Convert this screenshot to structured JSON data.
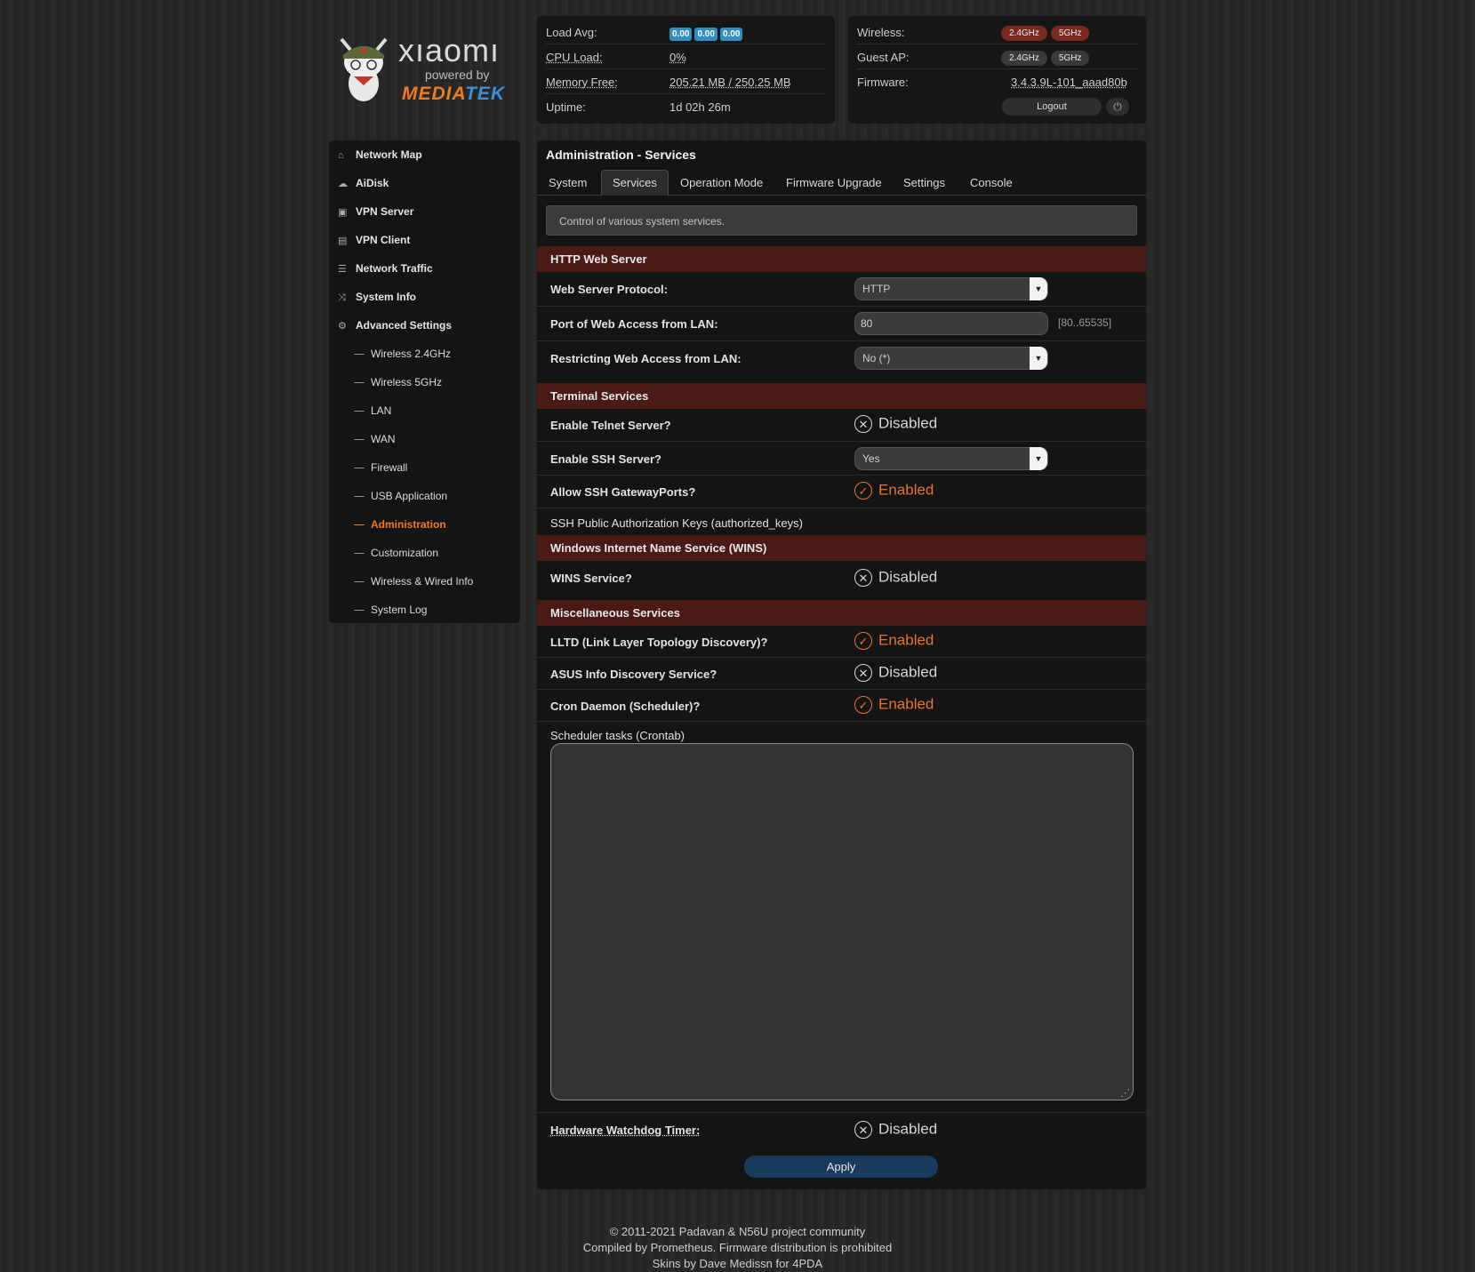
{
  "logo": {
    "brand": "xıaomı",
    "powered": "powered by",
    "mt1": "MEDIA",
    "mt2": "TEK"
  },
  "status_left": {
    "load_label": "Load Avg:",
    "load_values": [
      "0.00",
      "0.00",
      "0.00"
    ],
    "cpu_label": "CPU Load:",
    "cpu_value": "0%",
    "mem_label": "Memory Free:",
    "mem_value": "205.21 MB / 250.25 MB",
    "uptime_label": "Uptime:",
    "uptime_value": "1d 02h 26m"
  },
  "status_right": {
    "wireless_label": "Wireless:",
    "wireless_24": "2.4GHz",
    "wireless_5": "5GHz",
    "guest_label": "Guest AP:",
    "guest_24": "2.4GHz",
    "guest_5": "5GHz",
    "fw_label": "Firmware:",
    "fw_value": "3.4.3.9L-101_aaad80b",
    "logout": "Logout",
    "power_icon": "power-icon"
  },
  "sidebar": {
    "items": [
      {
        "label": "Network Map",
        "icon": "home-icon"
      },
      {
        "label": "AiDisk",
        "icon": "cloud-icon"
      },
      {
        "label": "VPN Server",
        "icon": "server-icon"
      },
      {
        "label": "VPN Client",
        "icon": "client-icon"
      },
      {
        "label": "Network Traffic",
        "icon": "list-icon"
      },
      {
        "label": "System Info",
        "icon": "shuffle-icon"
      },
      {
        "label": "Advanced Settings",
        "icon": "gear-icon"
      }
    ],
    "sub_items": [
      "Wireless 2.4GHz",
      "Wireless 5GHz",
      "LAN",
      "WAN",
      "Firewall",
      "USB Application",
      "Administration",
      "Customization",
      "Wireless & Wired Info",
      "System Log"
    ]
  },
  "main": {
    "title": "Administration - Services",
    "tabs": [
      "System",
      "Services",
      "Operation Mode",
      "Firmware Upgrade",
      "Settings",
      "Console"
    ],
    "description": "Control of various system services.",
    "sections": {
      "http": "HTTP Web Server",
      "terminal": "Terminal Services",
      "wins": "Windows Internet Name Service (WINS)",
      "misc": "Miscellaneous Services"
    },
    "fields": {
      "protocol_label": "Web Server Protocol:",
      "protocol_value": "HTTP",
      "port_label": "Port of Web Access from LAN:",
      "port_value": "80",
      "port_hint": "[80..65535]",
      "restrict_label": "Restricting Web Access from LAN:",
      "restrict_value": "No (*)",
      "telnet_label": "Enable Telnet Server?",
      "telnet_value": "Disabled",
      "ssh_label": "Enable SSH Server?",
      "ssh_value": "Yes",
      "gateway_label": "Allow SSH GatewayPorts?",
      "gateway_value": "Enabled",
      "keys_label": "SSH Public Authorization Keys (authorized_keys)",
      "wins_label": "WINS Service?",
      "wins_value": "Disabled",
      "lltd_label": "LLTD (Link Layer Topology Discovery)?",
      "lltd_value": "Enabled",
      "asus_label": "ASUS Info Discovery Service?",
      "asus_value": "Disabled",
      "cron_label": "Cron Daemon (Scheduler)?",
      "cron_value": "Enabled",
      "crontab_label": "Scheduler tasks (Crontab)",
      "watchdog_label": "Hardware Watchdog Timer:",
      "watchdog_value": "Disabled"
    },
    "apply": "Apply"
  },
  "footer": {
    "line1": "© 2011-2021 Padavan & N56U project community",
    "line2": "Compiled by Prometheus. Firmware distribution is prohibited",
    "line3": "Skins by Dave Medissn for 4PDA"
  },
  "colors": {
    "accent": "#f07a1e",
    "section_bg": "#4a1a17",
    "apply_bg": "#193a5a",
    "badge_blue": "#2f8fc4"
  }
}
